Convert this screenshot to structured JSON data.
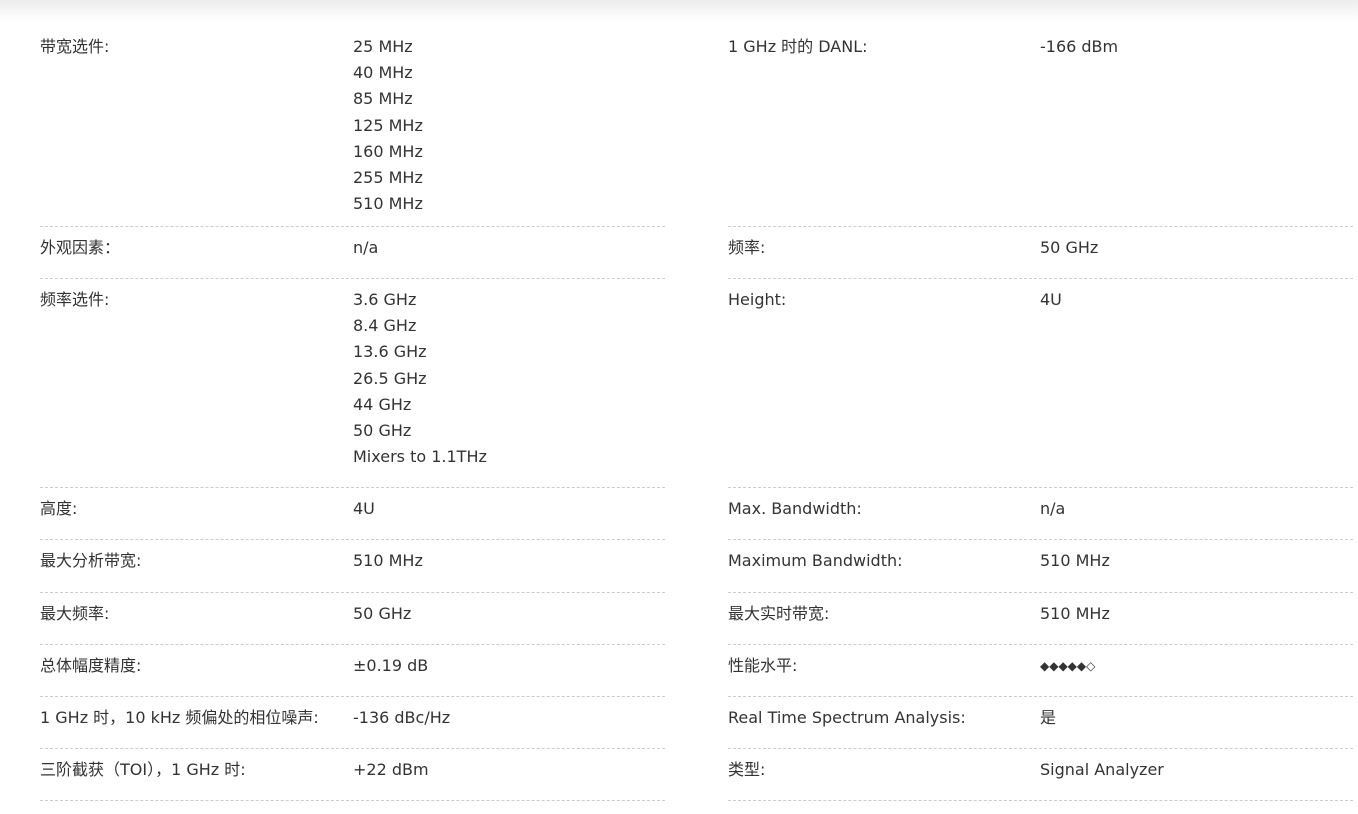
{
  "left": [
    {
      "label": "带宽选件:",
      "values": [
        "25 MHz",
        "40 MHz",
        "85 MHz",
        "125 MHz",
        "160 MHz",
        "255 MHz",
        "510 MHz"
      ]
    },
    {
      "label": "外观因素：",
      "values": [
        "n/a"
      ]
    },
    {
      "label": "频率选件:",
      "values": [
        "3.6 GHz",
        "8.4 GHz",
        "13.6 GHz",
        "26.5 GHz",
        "44 GHz",
        "50 GHz",
        "Mixers to 1.1THz"
      ]
    },
    {
      "label": "高度:",
      "values": [
        "4U"
      ]
    },
    {
      "label": "最大分析带宽:",
      "values": [
        "510 MHz"
      ]
    },
    {
      "label": "最大频率:",
      "values": [
        "50 GHz"
      ]
    },
    {
      "label": "总体幅度精度:",
      "values": [
        "±0.19 dB"
      ]
    },
    {
      "label": "1 GHz 时，10 kHz 频偏处的相位噪声:",
      "values": [
        "-136 dBc/Hz"
      ]
    },
    {
      "label": "三阶截获（TOI），1 GHz 时:",
      "values": [
        "+22 dBm"
      ]
    }
  ],
  "right": [
    {
      "label": "1 GHz 时的 DANL:",
      "values": [
        "-166 dBm"
      ]
    },
    {
      "label": "频率:",
      "values": [
        "50 GHz"
      ]
    },
    {
      "label": "Height:",
      "values": [
        "4U"
      ]
    },
    {
      "label": "Max. Bandwidth:",
      "values": [
        "n/a"
      ]
    },
    {
      "label": "Maximum Bandwidth:",
      "values": [
        "510 MHz"
      ]
    },
    {
      "label": "最大实时带宽:",
      "values": [
        "510 MHz"
      ]
    },
    {
      "label": "性能水平:",
      "values": [
        "◆◆◆◆◆◇"
      ]
    },
    {
      "label": "Real Time Spectrum Analysis:",
      "values": [
        "是"
      ]
    },
    {
      "label": "类型:",
      "values": [
        "Signal Analyzer"
      ]
    }
  ]
}
